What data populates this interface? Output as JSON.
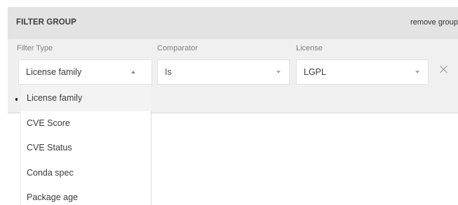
{
  "filter_group": {
    "title": "FILTER GROUP",
    "remove_label": "remove group"
  },
  "fields": {
    "filter_type": {
      "label": "Filter Type",
      "value": "License family"
    },
    "comparator": {
      "label": "Comparator",
      "value": "Is"
    },
    "license": {
      "label": "License",
      "value": "LGPL"
    }
  },
  "dropdown": {
    "items": [
      {
        "label": "License family",
        "highlighted": true
      },
      {
        "label": "CVE Score"
      },
      {
        "label": "CVE Status"
      },
      {
        "label": "Conda spec"
      },
      {
        "label": "Package age"
      }
    ]
  },
  "icons": {
    "filter_type_caret": "caret-up-icon",
    "comparator_caret": "caret-down-icon",
    "license_caret": "caret-down-icon",
    "remove_row": "close-icon"
  },
  "colors": {
    "panel_background": "#f0f0f0",
    "header_background": "#e3e3e3",
    "select_background": "#ffffff",
    "label_text": "#7f7f7f",
    "body_text": "#3a3a3a"
  }
}
